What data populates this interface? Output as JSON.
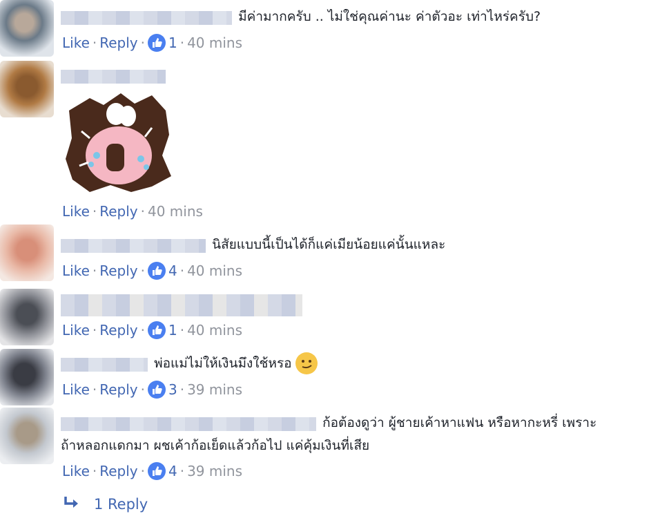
{
  "comments": [
    {
      "text": "มีค่ามากครับ .. ไม่ใช่คุณค่านะ ค่าตัวอะ เท่าไหร่ครับ?",
      "like": "Like",
      "reply": "Reply",
      "reactions": "1",
      "time": "40 mins"
    },
    {
      "text": "",
      "like": "Like",
      "reply": "Reply",
      "reactions": "",
      "time": "40 mins"
    },
    {
      "text": "นิสัยแบบนี้เป็นได้ก็แค่เมียน้อยแค่นั้นแหละ",
      "like": "Like",
      "reply": "Reply",
      "reactions": "4",
      "time": "40 mins"
    },
    {
      "text": "",
      "like": "Like",
      "reply": "Reply",
      "reactions": "1",
      "time": "40 mins"
    },
    {
      "text": "พ่อแม่ไม่ให้เงินมึงใช้หรอ",
      "like": "Like",
      "reply": "Reply",
      "reactions": "3",
      "time": "39 mins"
    },
    {
      "text_line1": "ก้อต้องดูว่า ผู้ชายเค้าหาแฟน หรือหากะหรี่ เพราะ",
      "text_line2": "ถ้าหลอกแดกมา ผชเค้าก้อเย็ดแล้วก้อไป แค่คุ้มเงินที่เสีย",
      "like": "Like",
      "reply": "Reply",
      "reactions": "4",
      "time": "39 mins"
    }
  ],
  "replies_link": "1 Reply",
  "icons": {
    "like": "thumbs-up-icon",
    "reply_arrow": "reply-arrow-icon",
    "emoji": "smirk-emoji-icon",
    "sticker": "crying-rabbit-sticker"
  },
  "colors": {
    "link": "#4267b2",
    "meta": "#90949c",
    "like_badge": "#4a7ff0",
    "text": "#1d2129"
  }
}
